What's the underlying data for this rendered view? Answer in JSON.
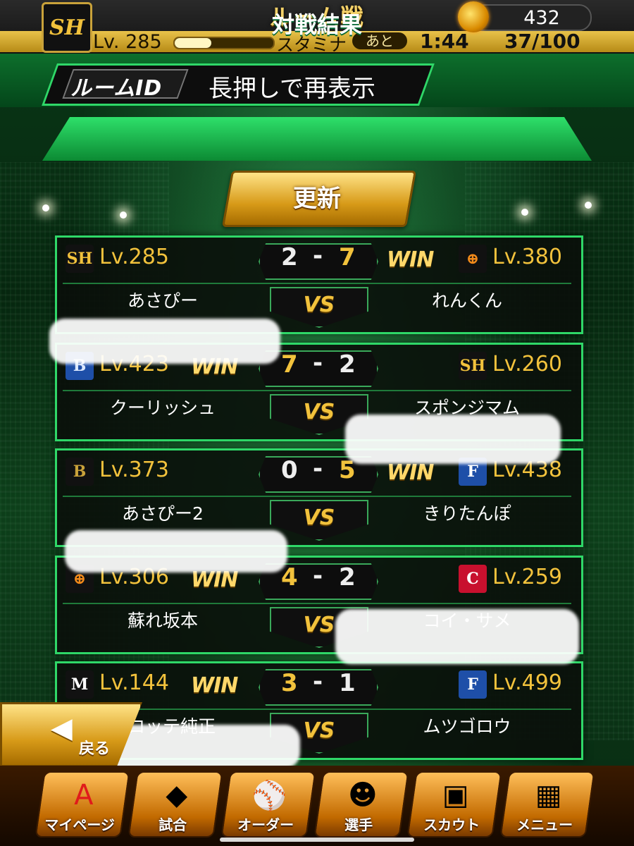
{
  "header": {
    "title": "ルーム戦",
    "team_badge": "SH",
    "player_level": "Lv. 285",
    "stamina_label": "スタミナ",
    "stamina_fill": 0.37,
    "ato_label": "あと",
    "timer": "1:44",
    "stamina_count": "37/100",
    "coin_count": "432"
  },
  "room": {
    "id_label": "ルームID",
    "hint": "長押しで再表示"
  },
  "results": {
    "title": "対戦結果",
    "refresh_label": "更新",
    "vs_label": "VS",
    "win_label": "WIN",
    "matches": [
      {
        "left": {
          "badge": "SH",
          "badge_color": "#111111",
          "badge_text_color": "#f2c23c",
          "level": "Lv.285",
          "name": "あさぴー"
        },
        "right": {
          "badge": "⊕",
          "badge_color": "#111111",
          "badge_text_color": "#f28a1a",
          "level": "Lv.380",
          "name": "れんくん"
        },
        "score_left": "2",
        "score_right": "7",
        "winner": "right"
      },
      {
        "left": {
          "badge": "B",
          "badge_color": "#1e4fa8",
          "badge_text_color": "#dbe8ff",
          "level": "Lv.423",
          "name": "クーリッシュ"
        },
        "right": {
          "badge": "SH",
          "badge_color": "#111111",
          "badge_text_color": "#f2c23c",
          "level": "Lv.260",
          "name": "スポンジマム"
        },
        "score_left": "7",
        "score_right": "2",
        "winner": "left"
      },
      {
        "left": {
          "badge": "B",
          "badge_color": "#111111",
          "badge_text_color": "#c9a23a",
          "level": "Lv.373",
          "name": "あさぴー2"
        },
        "right": {
          "badge": "F",
          "badge_color": "#1e4fa8",
          "badge_text_color": "#ffffff",
          "level": "Lv.438",
          "name": "きりたんぽ"
        },
        "score_left": "0",
        "score_right": "5",
        "winner": "right"
      },
      {
        "left": {
          "badge": "⊕",
          "badge_color": "#111111",
          "badge_text_color": "#f28a1a",
          "level": "Lv.306",
          "name": "蘇れ坂本"
        },
        "right": {
          "badge": "C",
          "badge_color": "#c8102e",
          "badge_text_color": "#ffffff",
          "level": "Lv.259",
          "name": "コイ・サメ"
        },
        "score_left": "4",
        "score_right": "2",
        "winner": "left"
      },
      {
        "left": {
          "badge": "M",
          "badge_color": "#111111",
          "badge_text_color": "#ffffff",
          "level": "Lv.144",
          "name": "@ロッテ純正"
        },
        "right": {
          "badge": "F",
          "badge_color": "#1e4fa8",
          "badge_text_color": "#ffffff",
          "level": "Lv.499",
          "name": "ムツゴロウ"
        },
        "score_left": "3",
        "score_right": "1",
        "winner": "left"
      }
    ]
  },
  "back_button": {
    "label": "戻る",
    "icon": "back-arrow-icon"
  },
  "bottom_nav": [
    {
      "label": "マイページ",
      "icon": "mypage-icon",
      "glyph": "A"
    },
    {
      "label": "試合",
      "icon": "stadium-icon",
      "glyph": "◆"
    },
    {
      "label": "オーダー",
      "icon": "order-icon",
      "glyph": "⚾"
    },
    {
      "label": "選手",
      "icon": "player-icon",
      "glyph": "☻"
    },
    {
      "label": "スカウト",
      "icon": "scout-card-icon",
      "glyph": "▣"
    },
    {
      "label": "メニュー",
      "icon": "menu-icon",
      "glyph": "▦"
    }
  ]
}
